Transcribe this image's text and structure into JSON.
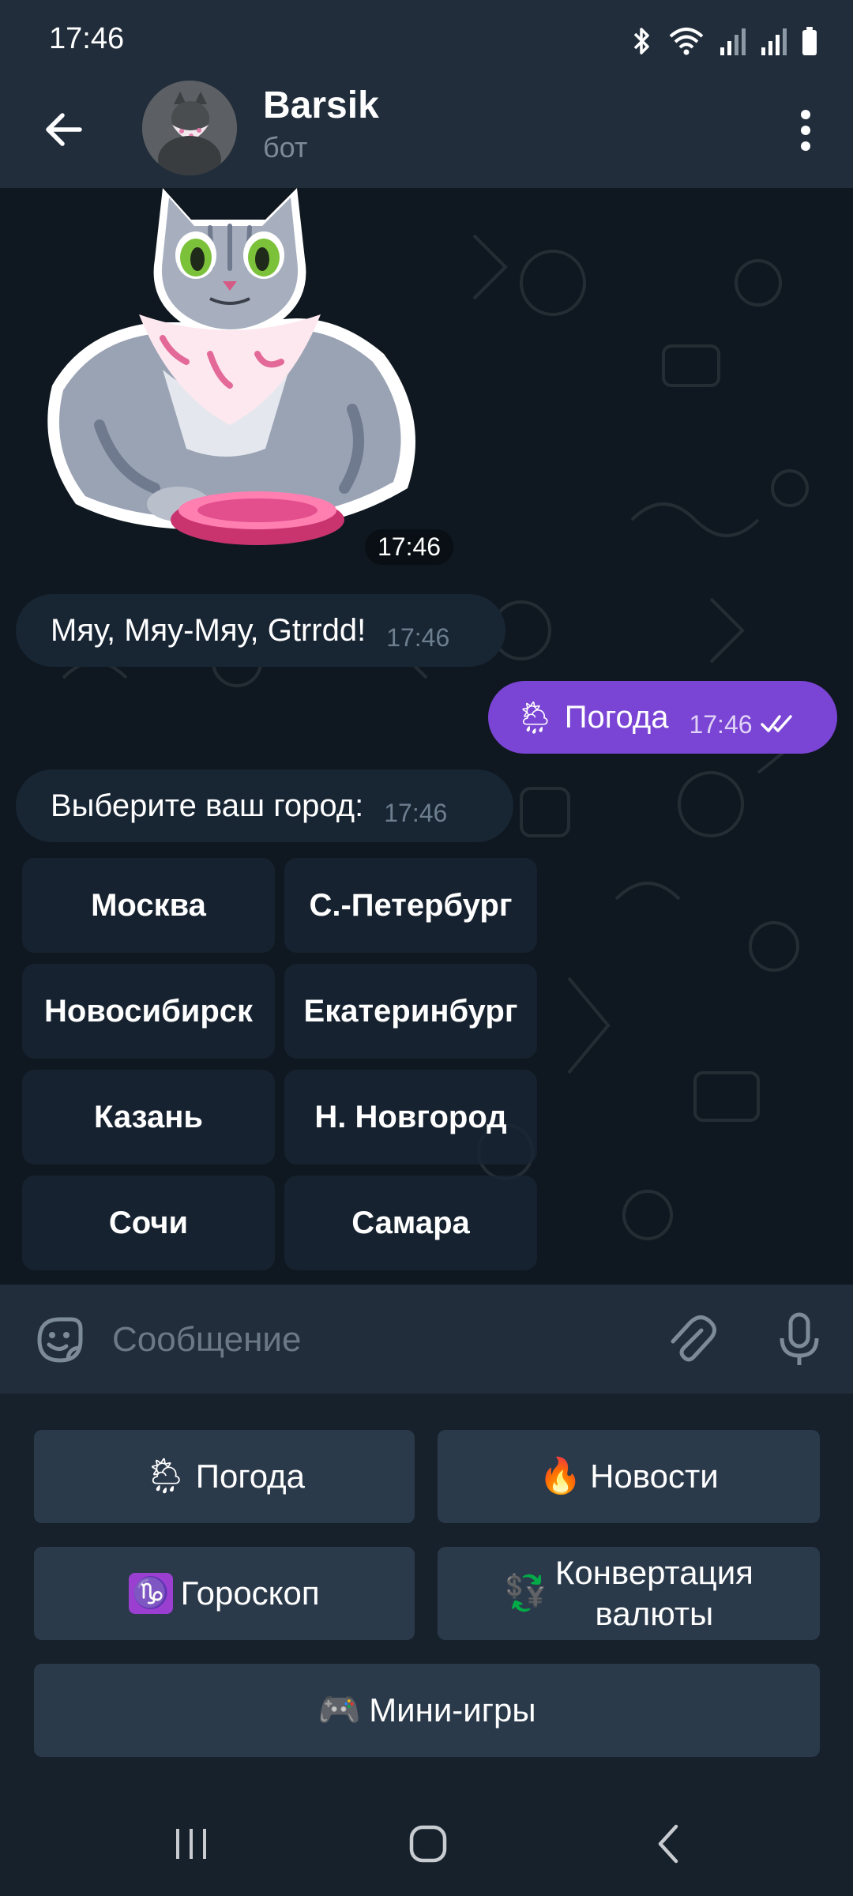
{
  "status_bar": {
    "time": "17:46"
  },
  "header": {
    "title": "Barsik",
    "subtitle": "бот"
  },
  "messages": {
    "sticker_time": "17:46",
    "msg1_text": "Мяу, Мяу-Мяу, Gtrrdd!",
    "msg1_time": "17:46",
    "msg2_emoji": "🌦",
    "msg2_text": "Погода",
    "msg2_time": "17:46",
    "msg3_text": "Выберите ваш город:",
    "msg3_time": "17:46"
  },
  "inline_keyboard": [
    "Москва",
    "С.-Петербург",
    "Новосибирск",
    "Екатеринбург",
    "Казань",
    "Н. Новгород",
    "Сочи",
    "Самара"
  ],
  "input": {
    "placeholder": "Сообщение"
  },
  "reply_keyboard": {
    "weather": {
      "emoji": "🌦",
      "label": "Погода"
    },
    "news": {
      "emoji": "🔥",
      "label": "Новости"
    },
    "horoscope": {
      "emoji": "♑",
      "label": "Гороскоп"
    },
    "conversion": {
      "emoji": "💱",
      "label_line1": "Конвертация",
      "label_line2": "валюты"
    },
    "games": {
      "emoji": "🎮",
      "label": "Мини-игры"
    }
  },
  "colors": {
    "accent_outgoing": "#7a44d4",
    "header_bg": "#212d3b",
    "chat_bg": "#0f1820",
    "incoming_bubble": "#182533"
  }
}
